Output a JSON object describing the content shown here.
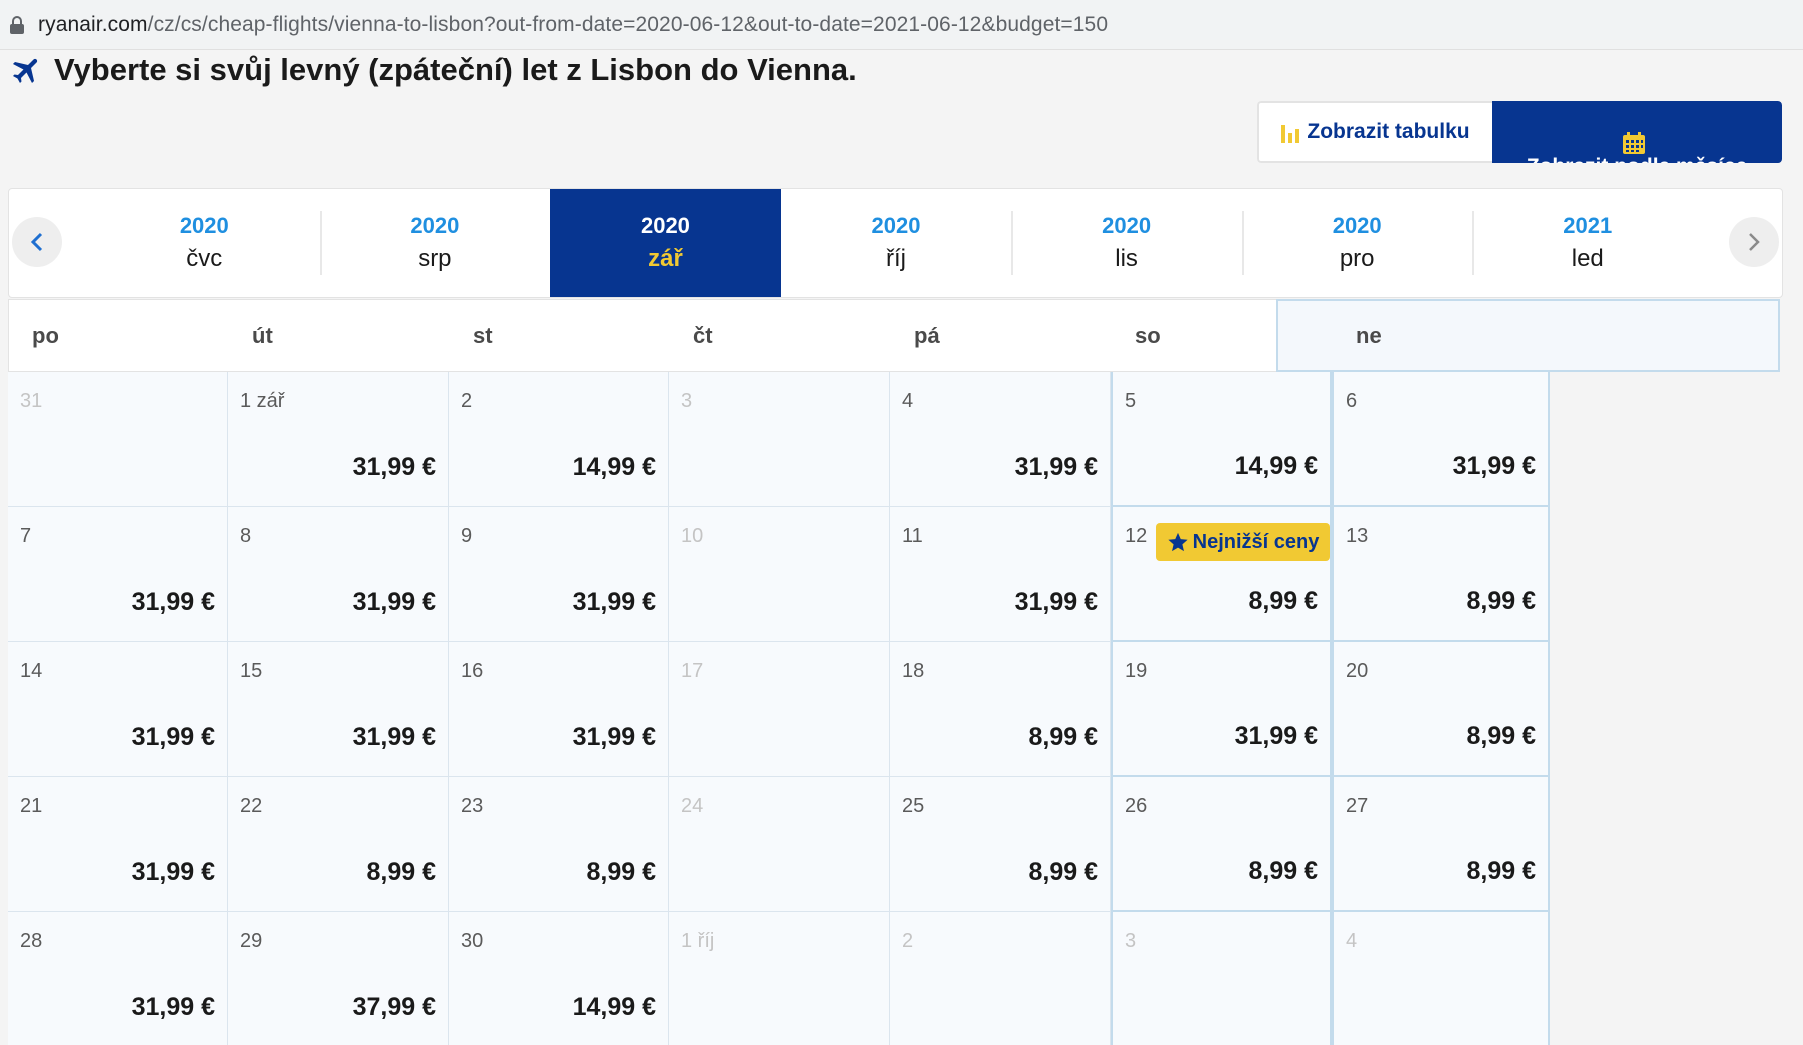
{
  "browser": {
    "url_host": "ryanair.com",
    "url_rest": "/cz/cs/cheap-flights/vienna-to-lisbon?out-from-date=2020-06-12&out-to-date=2021-06-12&budget=150"
  },
  "page": {
    "title": "Vyberte si svůj levný (zpáteční) let z Lisbon do Vienna."
  },
  "view_toggle": {
    "table_label": "Zobrazit tabulku",
    "month_label": "Zobrazit podle měsíce",
    "active": "month"
  },
  "months": [
    {
      "year": "2020",
      "month": "čvc"
    },
    {
      "year": "2020",
      "month": "srp"
    },
    {
      "year": "2020",
      "month": "zář",
      "active": true
    },
    {
      "year": "2020",
      "month": "říj"
    },
    {
      "year": "2020",
      "month": "lis"
    },
    {
      "year": "2020",
      "month": "pro"
    },
    {
      "year": "2021",
      "month": "led"
    }
  ],
  "weekdays": [
    "po",
    "út",
    "st",
    "čt",
    "pá",
    "so",
    "ne"
  ],
  "weeks": [
    [
      {
        "day": "31",
        "price": "",
        "faded": true
      },
      {
        "day": "1 zář",
        "price": "31,99 €"
      },
      {
        "day": "2",
        "price": "14,99 €"
      },
      {
        "day": "3",
        "price": "",
        "faded": true
      },
      {
        "day": "4",
        "price": "31,99 €"
      },
      {
        "day": "5",
        "price": "14,99 €"
      },
      {
        "day": "6",
        "price": "31,99 €"
      }
    ],
    [
      {
        "day": "7",
        "price": "31,99 €"
      },
      {
        "day": "8",
        "price": "31,99 €"
      },
      {
        "day": "9",
        "price": "31,99 €"
      },
      {
        "day": "10",
        "price": "",
        "faded": true
      },
      {
        "day": "11",
        "price": "31,99 €"
      },
      {
        "day": "12",
        "price": "8,99 €",
        "badge": "Nejnižší ceny"
      },
      {
        "day": "13",
        "price": "8,99 €"
      }
    ],
    [
      {
        "day": "14",
        "price": "31,99 €"
      },
      {
        "day": "15",
        "price": "31,99 €"
      },
      {
        "day": "16",
        "price": "31,99 €"
      },
      {
        "day": "17",
        "price": "",
        "faded": true
      },
      {
        "day": "18",
        "price": "8,99 €"
      },
      {
        "day": "19",
        "price": "31,99 €"
      },
      {
        "day": "20",
        "price": "8,99 €"
      }
    ],
    [
      {
        "day": "21",
        "price": "31,99 €"
      },
      {
        "day": "22",
        "price": "8,99 €"
      },
      {
        "day": "23",
        "price": "8,99 €"
      },
      {
        "day": "24",
        "price": "",
        "faded": true
      },
      {
        "day": "25",
        "price": "8,99 €"
      },
      {
        "day": "26",
        "price": "8,99 €"
      },
      {
        "day": "27",
        "price": "8,99 €"
      }
    ],
    [
      {
        "day": "28",
        "price": "31,99 €"
      },
      {
        "day": "29",
        "price": "37,99 €"
      },
      {
        "day": "30",
        "price": "14,99 €"
      },
      {
        "day": "1 říj",
        "price": "",
        "faded": true
      },
      {
        "day": "2",
        "price": "",
        "faded": true
      },
      {
        "day": "3",
        "price": "",
        "faded": true
      },
      {
        "day": "4",
        "price": "",
        "faded": true
      }
    ]
  ],
  "colors": {
    "brand_navy": "#073590",
    "brand_yellow": "#f1c933",
    "year_blue": "#1f8fe0"
  }
}
